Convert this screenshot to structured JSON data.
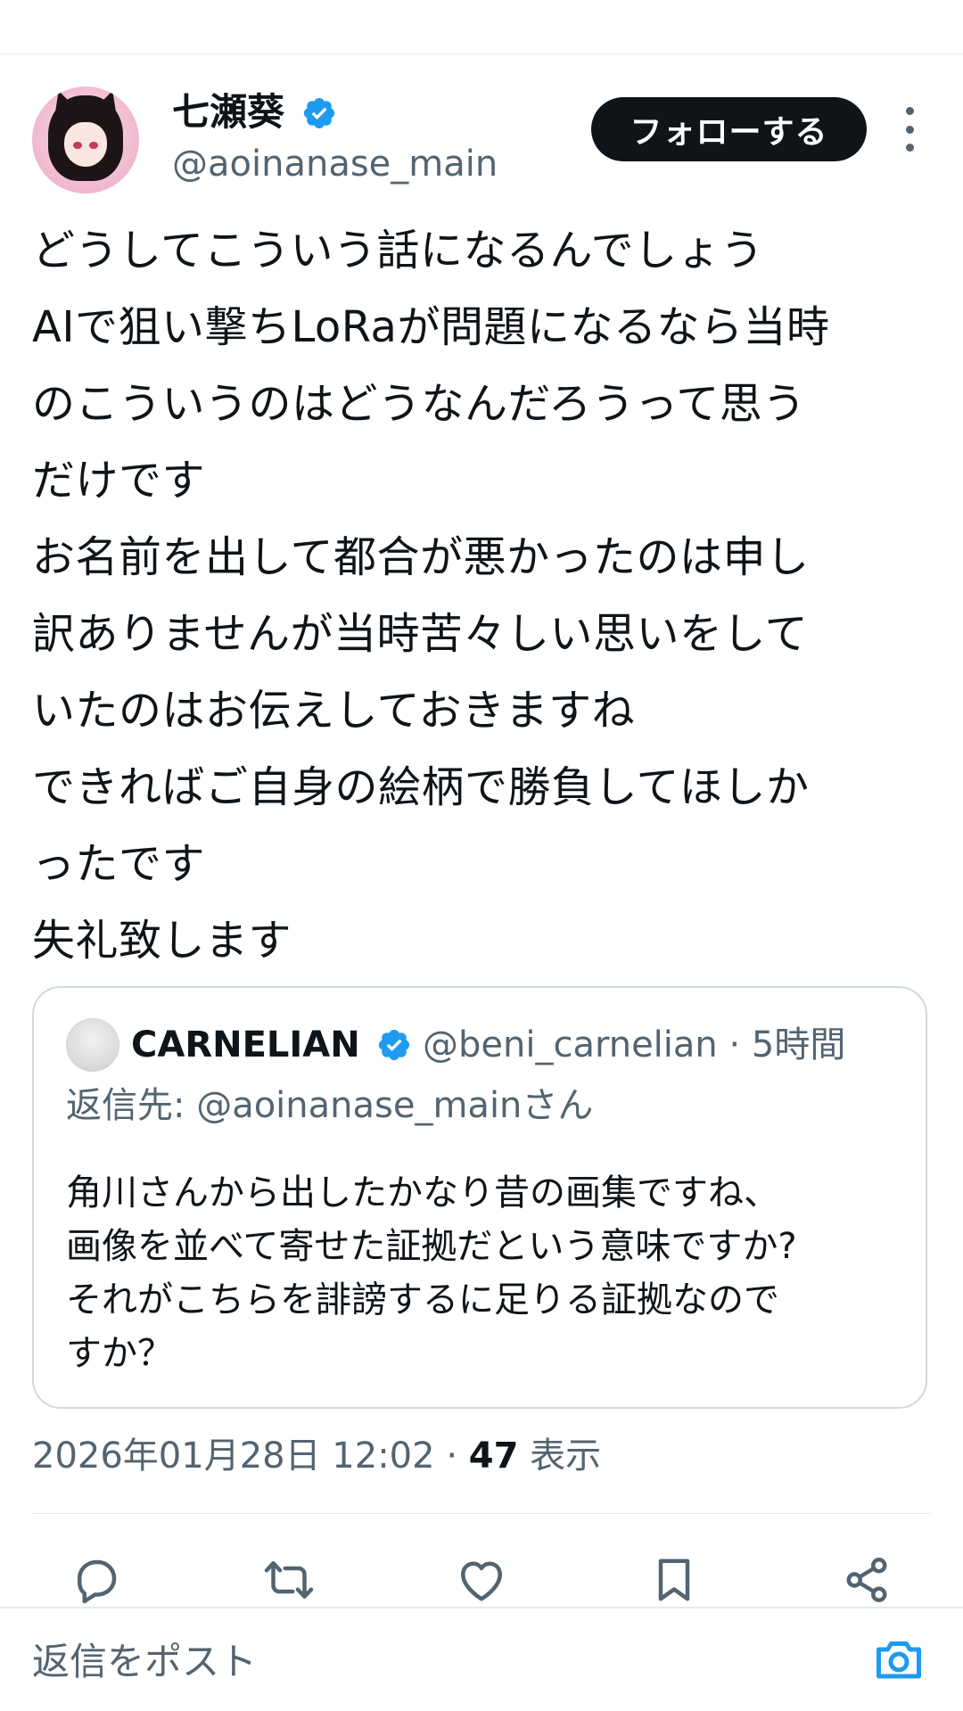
{
  "post": {
    "author": {
      "display_name": "七瀬葵",
      "handle": "@aoinanase_main",
      "verified": true
    },
    "follow_label": "フォローする",
    "body_lines": [
      "どうしてこういう話になるんでしょう",
      "AIで狙い撃ちLoRaが問題になるなら当時",
      "のこういうのはどうなんだろうって思う",
      "だけです",
      "お名前を出して都合が悪かったのは申し",
      "訳ありませんが当時苦々しい思いをして",
      "いたのはお伝えしておきますね",
      "できればご自身の絵柄で勝負してほしか",
      "ったです",
      "失礼致します"
    ],
    "timestamp": "2026年01月28日 12:02",
    "separator": "·",
    "views_count": "47",
    "views_label": "表示"
  },
  "quote": {
    "display_name": "CARNELIAN",
    "handle": "@beni_carnelian",
    "separator": "·",
    "time": "5時間",
    "reply_to": "返信先: @aoinanase_mainさん",
    "text_lines": [
      "角川さんから出したかなり昔の画集ですね、",
      "画像を並べて寄せた証拠だという意味ですか?",
      "それがこちらを誹謗するに足りる証拠なので",
      "すか？"
    ]
  },
  "actions": [
    "reply-icon",
    "repost-icon",
    "like-icon",
    "bookmark-icon",
    "share-icon"
  ],
  "reply_bar": {
    "placeholder": "返信をポスト"
  },
  "colors": {
    "verified": "#1d9bf0",
    "primary_text": "#0f1419",
    "secondary_text": "#536471",
    "border": "#cfd9de"
  }
}
